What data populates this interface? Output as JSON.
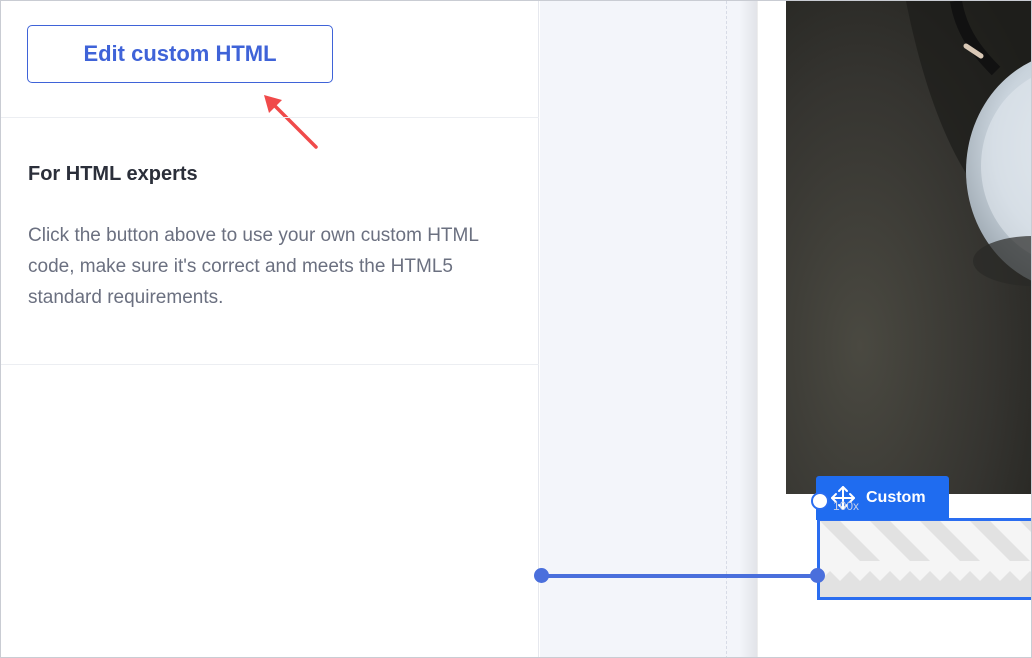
{
  "left_panel": {
    "edit_button_label": "Edit custom HTML",
    "section_title": "For HTML experts",
    "section_text": "Click the button above to use your own custom HTML code, make sure it's correct and meets the HTML5 standard requirements."
  },
  "canvas": {
    "block_tag_label": "Custom",
    "block_size_label": "100x",
    "move_icon": "move-arrows-icon"
  },
  "colors": {
    "accent": "#3f63d8",
    "tag_blue": "#1f6cf0",
    "annotation_arrow": "#f04a4a"
  }
}
